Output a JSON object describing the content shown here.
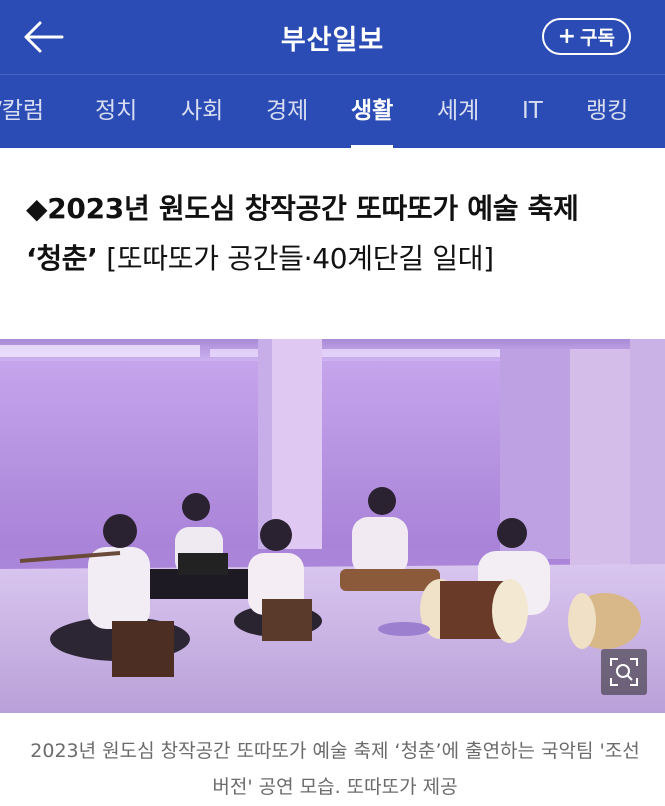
{
  "header": {
    "brand": "부산일보",
    "subscribe_label": "구독",
    "back_icon": "back-arrow-icon",
    "colors": {
      "bar": "#2b4bb5",
      "text": "#ffffff"
    }
  },
  "nav": {
    "items": [
      {
        "label": "/칼럼"
      },
      {
        "label": "정치"
      },
      {
        "label": "사회"
      },
      {
        "label": "경제"
      },
      {
        "label": "생활",
        "active": true
      },
      {
        "label": "세계"
      },
      {
        "label": "IT"
      },
      {
        "label": "랭킹"
      }
    ]
  },
  "article": {
    "bullet": "◆",
    "title_bold": "2023년 원도심 창작공간 또따또가 예술 축제",
    "title_bold_2": "‘청춘’",
    "title_rest": " [또따또가 공간들·40계단길 일대]",
    "photo_caption": "2023년 원도심 창작공간 또따또가 예술 축제 ‘청춘’에 출연하는 국악팀 '조선버전' 공연 모습. 또따또가 제공",
    "zoom_icon": "zoom-icon"
  }
}
